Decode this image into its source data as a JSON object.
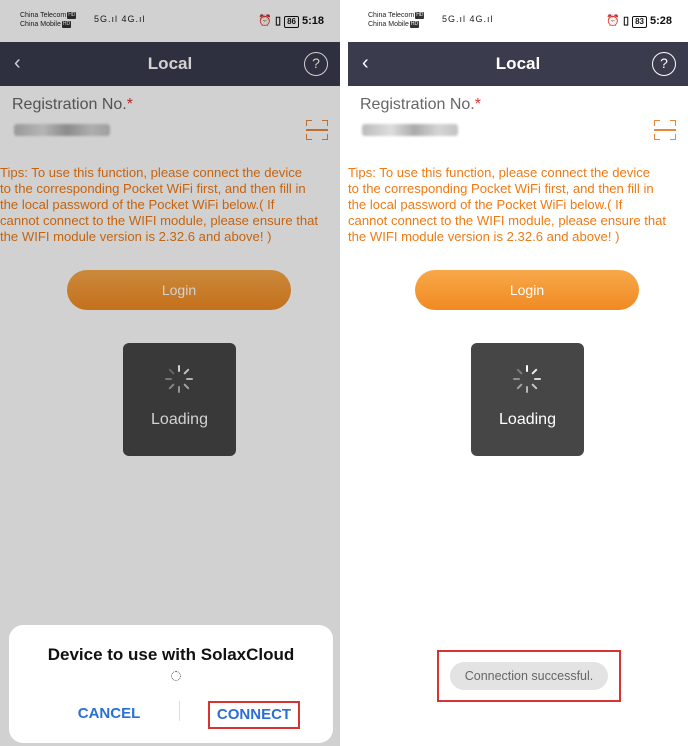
{
  "left": {
    "status": {
      "carrier1": "China Telecom",
      "carrier2": "China Mobile",
      "carrier1_tag": "HD",
      "carrier2_tag": "HD",
      "signal": "5G.ıl 4G.ıl",
      "icons": "⏰ ▯",
      "battery": "86",
      "time": "5:18"
    },
    "nav": {
      "back": "‹",
      "title": "Local",
      "help": "?"
    },
    "form": {
      "reg_label": "Registration No.",
      "required_mark": "*",
      "tips": [
        "Tips: To use this function, please connect the device",
        "to the corresponding Pocket WiFi first, and then fill in",
        "the local password of the Pocket WiFi below.( If",
        "cannot connect to the WIFI module, please ensure that",
        "the WIFI module version is 2.32.6 and above! )"
      ]
    },
    "login_label": "Login",
    "loading_label": "Loading",
    "dialog": {
      "title": "Device to use with SolaxCloud",
      "cancel": "CANCEL",
      "connect": "CONNECT"
    }
  },
  "right": {
    "status": {
      "carrier1": "China Telecom",
      "carrier2": "China Mobile",
      "carrier1_tag": "HD",
      "carrier2_tag": "HD",
      "signal": "5G.ıl 4G.ıl",
      "icons": "⏰ ▯",
      "battery": "83",
      "time": "5:28"
    },
    "nav": {
      "back": "‹",
      "title": "Local",
      "help": "?"
    },
    "form": {
      "reg_label": "Registration No.",
      "required_mark": "*",
      "tips": [
        "Tips: To use this function, please connect the device",
        "to the corresponding Pocket WiFi first, and then fill in",
        "the local password of the Pocket WiFi below.( If",
        "cannot connect to the WIFI module, please ensure that",
        "the WIFI module version is 2.32.6 and above! )"
      ]
    },
    "login_label": "Login",
    "loading_label": "Loading",
    "toast": "Connection successful."
  },
  "colors": {
    "navbar": "#3a3b4d",
    "accent_orange": "#f08a22",
    "tips_orange": "#f07a14",
    "dialog_button_blue": "#2a6fd6",
    "highlight_red": "#d63333"
  }
}
